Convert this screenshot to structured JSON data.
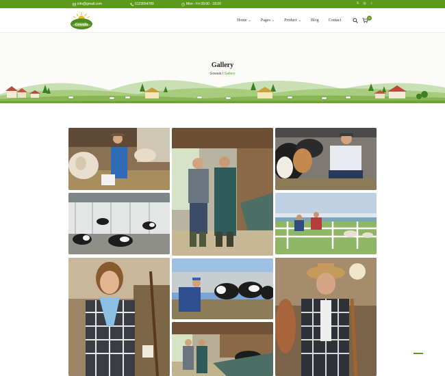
{
  "topbar": {
    "email": "info@gmail.com",
    "phone": "0123654789",
    "hours": "Mon - Fri 09:00 - 18:00",
    "social": [
      "x-icon",
      "instagram-icon",
      "tiktok-icon"
    ]
  },
  "header": {
    "logo_text": "Gowala",
    "nav": [
      {
        "label": "Home",
        "has_dropdown": true
      },
      {
        "label": "Pages",
        "has_dropdown": true
      },
      {
        "label": "Product",
        "has_dropdown": true
      },
      {
        "label": "Blog",
        "has_dropdown": false
      },
      {
        "label": "Contact",
        "has_dropdown": false
      }
    ],
    "cart_count": "0"
  },
  "hero": {
    "title": "Gallery",
    "breadcrumb_home": "Gowala",
    "breadcrumb_sep": " / ",
    "breadcrumb_current": "Gallery"
  },
  "colors": {
    "brand_green": "#5b9a1c",
    "text_dark": "#222222"
  }
}
